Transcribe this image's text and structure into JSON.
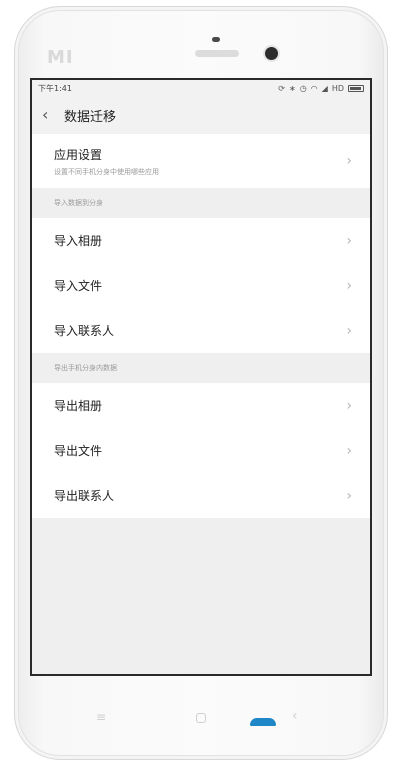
{
  "device": {
    "logo": "MI"
  },
  "status_bar": {
    "time": "下午1:41",
    "network": "HD"
  },
  "header": {
    "title": "数据迁移"
  },
  "app_settings": {
    "label": "应用设置",
    "description": "设置不同手机分身中使用哪些应用"
  },
  "import_section": {
    "header": "导入数据到分身",
    "items": [
      {
        "label": "导入相册"
      },
      {
        "label": "导入文件"
      },
      {
        "label": "导入联系人"
      }
    ]
  },
  "export_section": {
    "header": "导出手机分身内数据",
    "items": [
      {
        "label": "导出相册"
      },
      {
        "label": "导出文件"
      },
      {
        "label": "导出联系人"
      }
    ]
  },
  "icons": {
    "back": "back-arrow-icon",
    "chevron": "chevron-right-icon",
    "menu_key": "menu-key-icon",
    "home_key": "home-key-icon",
    "back_key": "back-key-icon"
  },
  "colors": {
    "screen_background": "#efefef",
    "card_background": "#ffffff",
    "home_light": "#1f86c8"
  }
}
